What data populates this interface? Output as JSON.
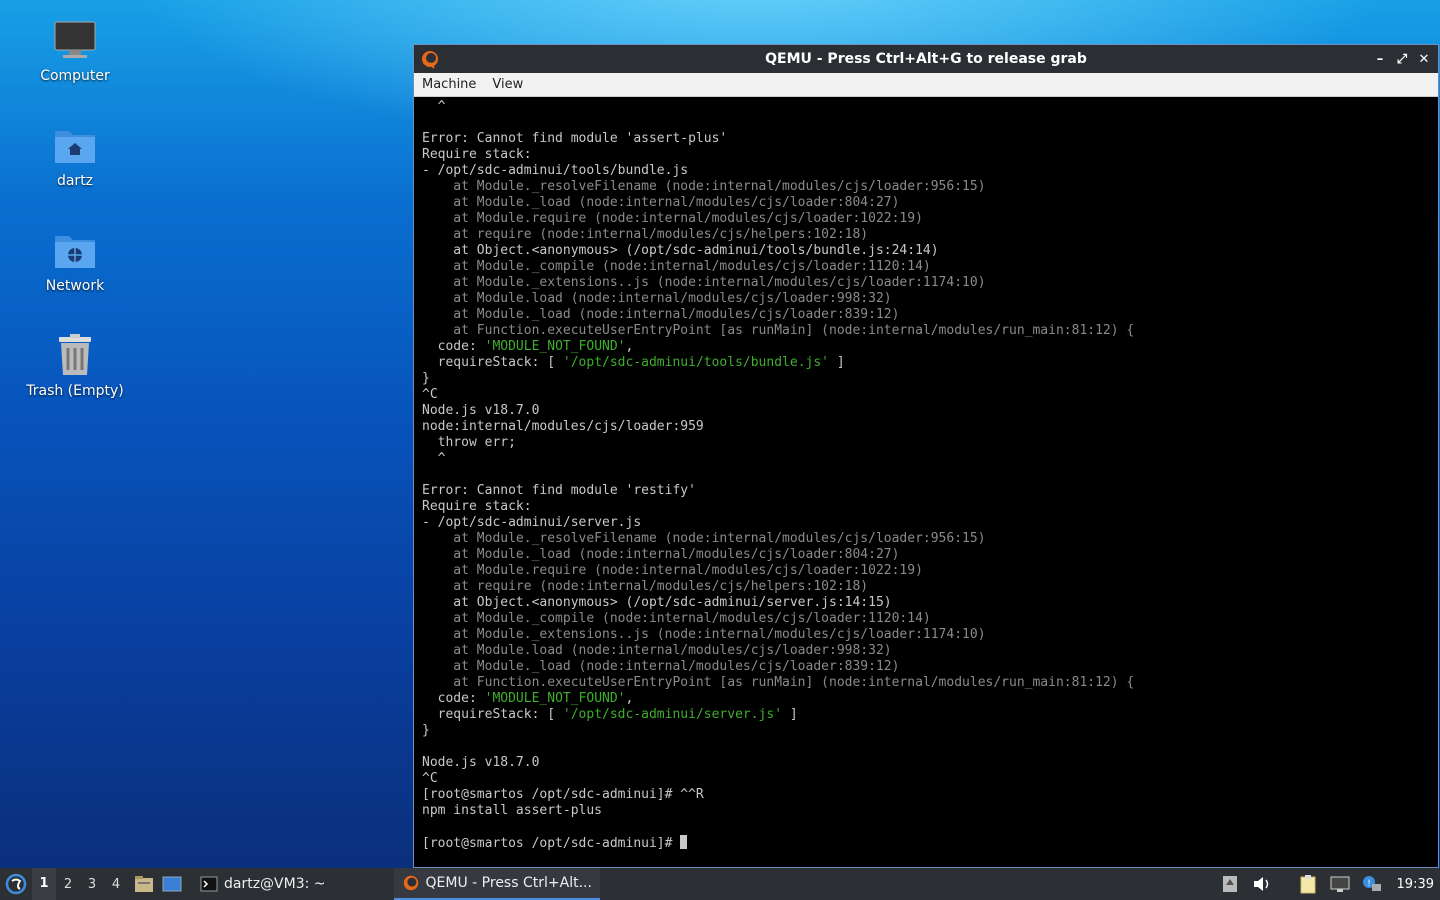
{
  "desktop": {
    "icons": [
      {
        "label": "Computer"
      },
      {
        "label": "dartz"
      },
      {
        "label": "Network"
      },
      {
        "label": "Trash (Empty)"
      }
    ]
  },
  "window": {
    "title": "QEMU - Press Ctrl+Alt+G to release grab",
    "menu": [
      "Machine",
      "View"
    ],
    "controls": [
      "minimize",
      "maximize",
      "close"
    ]
  },
  "terminal": {
    "lines": [
      {
        "t": "  ^"
      },
      {
        "t": ""
      },
      {
        "t": "Error: Cannot find module 'assert-plus'"
      },
      {
        "t": "Require stack:"
      },
      {
        "t": "- /opt/sdc-adminui/tools/bundle.js"
      },
      {
        "t": "    at Module._resolveFilename (node:internal/modules/cjs/loader:956:15)",
        "c": "dim"
      },
      {
        "t": "    at Module._load (node:internal/modules/cjs/loader:804:27)",
        "c": "dim"
      },
      {
        "t": "    at Module.require (node:internal/modules/cjs/loader:1022:19)",
        "c": "dim"
      },
      {
        "t": "    at require (node:internal/modules/cjs/helpers:102:18)",
        "c": "dim"
      },
      {
        "t": "    at Object.<anonymous> (/opt/sdc-adminui/tools/bundle.js:24:14)"
      },
      {
        "t": "    at Module._compile (node:internal/modules/cjs/loader:1120:14)",
        "c": "dim"
      },
      {
        "t": "    at Module._extensions..js (node:internal/modules/cjs/loader:1174:10)",
        "c": "dim"
      },
      {
        "t": "    at Module.load (node:internal/modules/cjs/loader:998:32)",
        "c": "dim"
      },
      {
        "t": "    at Module._load (node:internal/modules/cjs/loader:839:12)",
        "c": "dim"
      },
      {
        "t": "    at Function.executeUserEntryPoint [as runMain] (node:internal/modules/run_main:81:12) {",
        "c": "dim"
      },
      {
        "t": "  code: ",
        "g": "'MODULE_NOT_FOUND'",
        "s": ","
      },
      {
        "t": "  requireStack: [ ",
        "g": "'/opt/sdc-adminui/tools/bundle.js'",
        "s": " ]"
      },
      {
        "t": "}"
      },
      {
        "t": "^C"
      },
      {
        "t": "Node.js v18.7.0"
      },
      {
        "t": "node:internal/modules/cjs/loader:959"
      },
      {
        "t": "  throw err;"
      },
      {
        "t": "  ^"
      },
      {
        "t": ""
      },
      {
        "t": "Error: Cannot find module 'restify'"
      },
      {
        "t": "Require stack:"
      },
      {
        "t": "- /opt/sdc-adminui/server.js"
      },
      {
        "t": "    at Module._resolveFilename (node:internal/modules/cjs/loader:956:15)",
        "c": "dim"
      },
      {
        "t": "    at Module._load (node:internal/modules/cjs/loader:804:27)",
        "c": "dim"
      },
      {
        "t": "    at Module.require (node:internal/modules/cjs/loader:1022:19)",
        "c": "dim"
      },
      {
        "t": "    at require (node:internal/modules/cjs/helpers:102:18)",
        "c": "dim"
      },
      {
        "t": "    at Object.<anonymous> (/opt/sdc-adminui/server.js:14:15)"
      },
      {
        "t": "    at Module._compile (node:internal/modules/cjs/loader:1120:14)",
        "c": "dim"
      },
      {
        "t": "    at Module._extensions..js (node:internal/modules/cjs/loader:1174:10)",
        "c": "dim"
      },
      {
        "t": "    at Module.load (node:internal/modules/cjs/loader:998:32)",
        "c": "dim"
      },
      {
        "t": "    at Module._load (node:internal/modules/cjs/loader:839:12)",
        "c": "dim"
      },
      {
        "t": "    at Function.executeUserEntryPoint [as runMain] (node:internal/modules/run_main:81:12) {",
        "c": "dim"
      },
      {
        "t": "  code: ",
        "g": "'MODULE_NOT_FOUND'",
        "s": ","
      },
      {
        "t": "  requireStack: [ ",
        "g": "'/opt/sdc-adminui/server.js'",
        "s": " ]"
      },
      {
        "t": "}"
      },
      {
        "t": ""
      },
      {
        "t": "Node.js v18.7.0"
      },
      {
        "t": "^C"
      },
      {
        "t": "[root@smartos /opt/sdc-adminui]# ^^R"
      },
      {
        "t": "npm install assert-plus"
      },
      {
        "t": ""
      },
      {
        "t": "[root@smartos /opt/sdc-adminui]# ",
        "cursor": true
      }
    ]
  },
  "taskbar": {
    "workspaces": [
      "1",
      "2",
      "3",
      "4"
    ],
    "active_workspace": "1",
    "tasks": [
      {
        "label": "dartz@VM3: ~",
        "icon": "terminal-icon"
      },
      {
        "label": "QEMU - Press Ctrl+Alt...",
        "icon": "qemu-icon",
        "active": true
      }
    ],
    "clock": "19:39"
  },
  "colors": {
    "terminal_bg": "#000000",
    "terminal_fg": "#c8c8c8",
    "terminal_dim": "#8a8a8a",
    "terminal_green": "#3fae2d",
    "taskbar_bg": "#2c2f34",
    "titlebar_bg": "#2b2e33"
  }
}
